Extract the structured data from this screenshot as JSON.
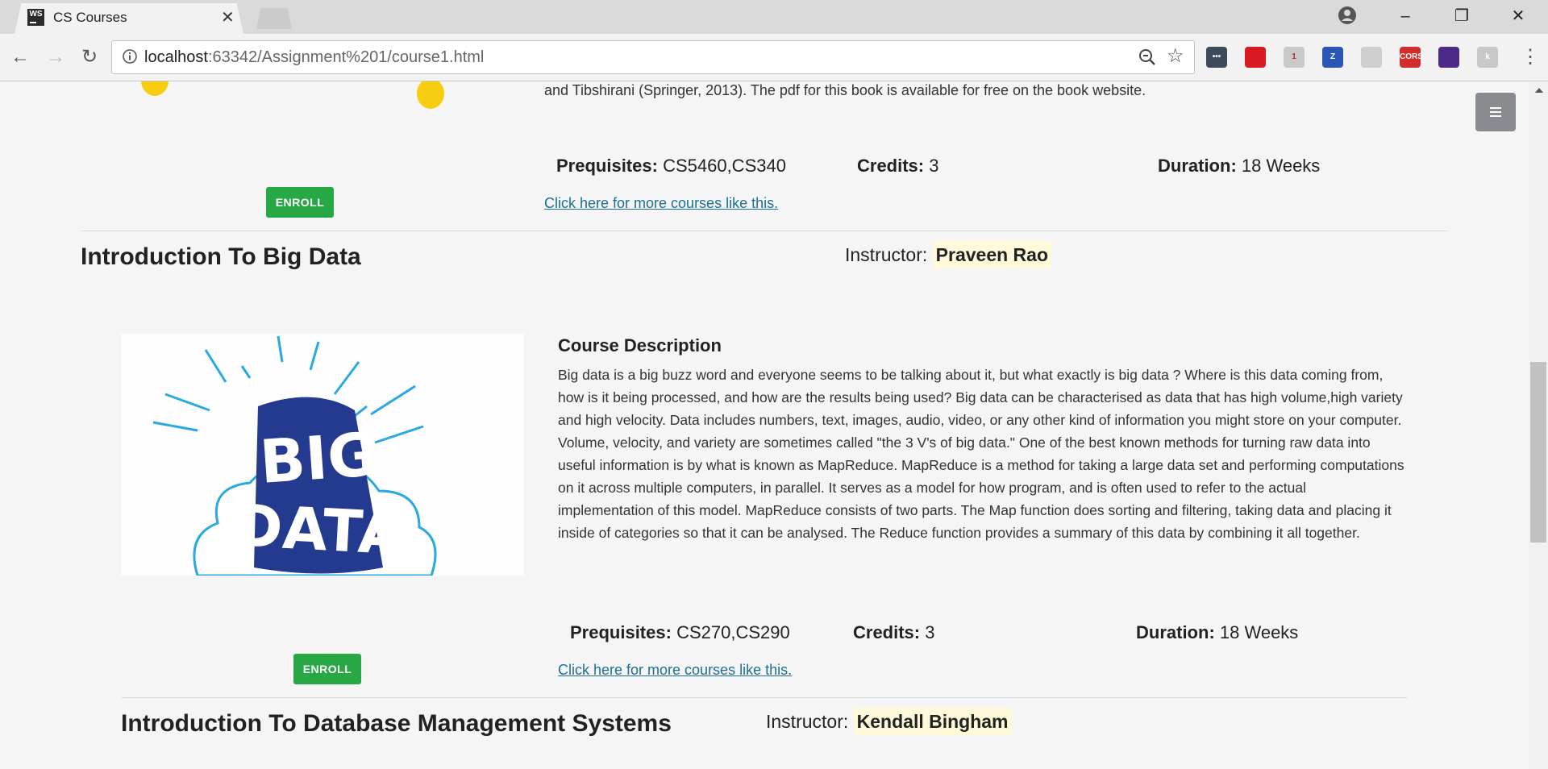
{
  "browser": {
    "tab_title": "CS Courses",
    "favicon_text": "WS",
    "url_host": "localhost",
    "url_path": ":63342/Assignment%201/course1.html",
    "extensions": [
      {
        "name": "ellipsis-ext-icon",
        "label": "•••",
        "color": "#3c4a5c"
      },
      {
        "name": "ublock-ext-icon",
        "label": "",
        "color": "#d81b22"
      },
      {
        "name": "shield-ext-icon",
        "label": "1",
        "color": "#c9c9c9"
      },
      {
        "name": "zotero-ext-icon",
        "label": "Z",
        "color": "#2b56b6"
      },
      {
        "name": "feather-ext-icon",
        "label": "",
        "color": "#cfcfcf"
      },
      {
        "name": "cors-ext-icon",
        "label": "CORS",
        "color": "#d32c2c"
      },
      {
        "name": "book-ext-icon",
        "label": "",
        "color": "#4b2a8a"
      },
      {
        "name": "k-ext-icon",
        "label": "k",
        "color": "#c8c8c8"
      }
    ]
  },
  "previous_course": {
    "description_tail": "and Tibshirani (Springer, 2013). The pdf for this book is available for free on the book website.",
    "prerequisites_label": "Prequisites:",
    "prerequisites_value": "CS5460,CS340",
    "credits_label": "Credits:",
    "credits_value": "3",
    "duration_label": "Duration:",
    "duration_value": "18 Weeks",
    "enroll_label": "ENROLL",
    "more_link": "Click here for more courses like this."
  },
  "course": {
    "title": "Introduction To Big Data",
    "instructor_label": "Instructor:",
    "instructor_name": "Praveen Rao",
    "image_text_line1": "BIG",
    "image_text_line2": "DATA",
    "description_heading": "Course Description",
    "description": "Big data is a big buzz word and everyone seems to be talking about it, but what exactly is big data ? Where is this data coming from, how is it being processed, and how are the results being used? Big data can be characterised as data that has high volume,high variety and high velocity. Data includes numbers, text, images, audio, video, or any other kind of information you might store on your computer. Volume, velocity, and variety are sometimes called \"the 3 V's of big data.\" One of the best known methods for turning raw data into useful information is by what is known as MapReduce. MapReduce is a method for taking a large data set and performing computations on it across multiple computers, in parallel. It serves as a model for how program, and is often used to refer to the actual implementation of this model. MapReduce consists of two parts. The Map function does sorting and filtering, taking data and placing it inside of categories so that it can be analysed. The Reduce function provides a summary of this data by combining it all together.",
    "prerequisites_label": "Prequisites:",
    "prerequisites_value": "CS270,CS290",
    "credits_label": "Credits:",
    "credits_value": "3",
    "duration_label": "Duration:",
    "duration_value": "18 Weeks",
    "enroll_label": "ENROLL",
    "more_link": "Click here for more courses like this."
  },
  "next_course": {
    "title": "Introduction To Database Management Systems",
    "instructor_label": "Instructor:",
    "instructor_name": "Kendall Bingham"
  }
}
